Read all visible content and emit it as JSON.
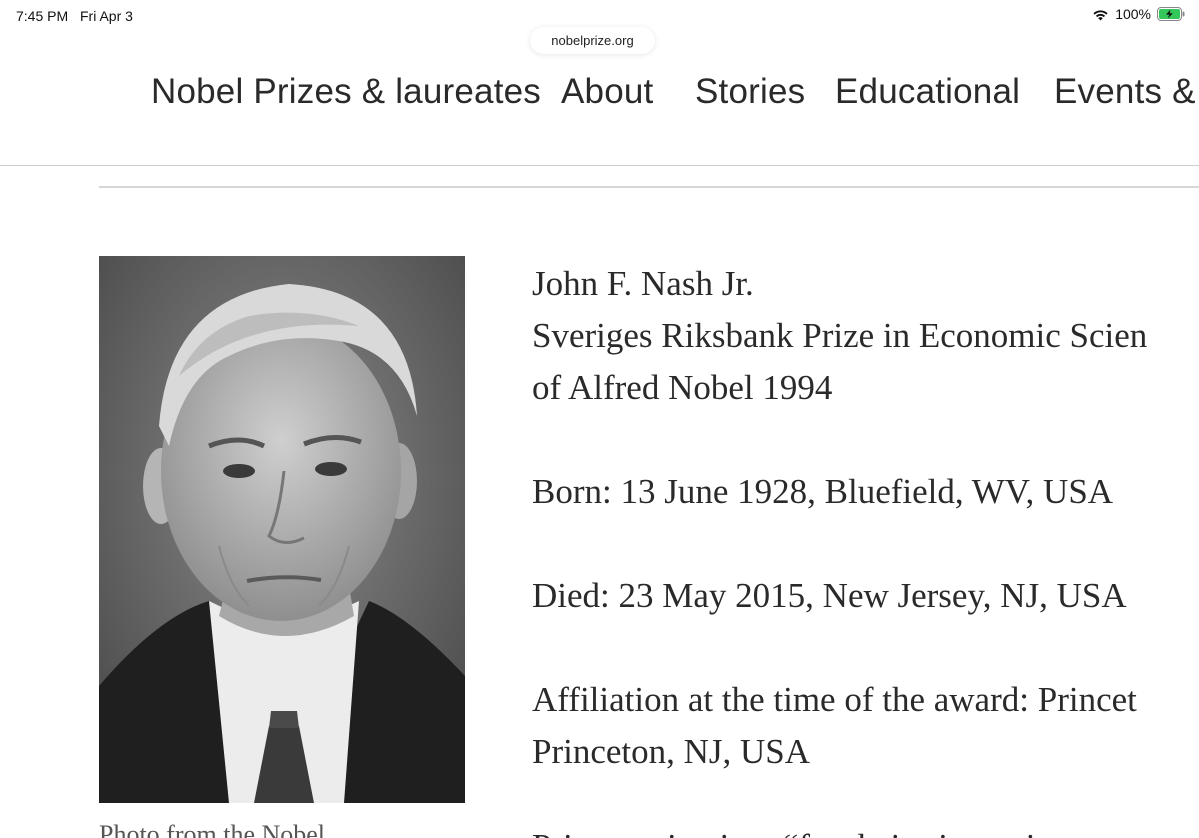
{
  "status_bar": {
    "time": "7:45 PM",
    "date": "Fri Apr 3",
    "battery_percent": "100%",
    "wifi_icon": "wifi-icon",
    "battery_icon": "battery-charging-icon"
  },
  "url_bar": {
    "domain": "nobelprize.org"
  },
  "nav": {
    "items": [
      {
        "label": "Nobel Prizes & laureates"
      },
      {
        "label": "About"
      },
      {
        "label": "Stories"
      },
      {
        "label": "Educational"
      },
      {
        "label": "Events & r"
      }
    ]
  },
  "laureate": {
    "name": "John F. Nash Jr.",
    "prize_line1": "Sveriges Riksbank Prize in Economic Scien",
    "prize_line2": "of Alfred Nobel 1994",
    "born": "Born: 13 June 1928, Bluefield, WV, USA",
    "died": "Died: 23 May 2015, New Jersey, NJ, USA",
    "affiliation_line1": "Affiliation at the time of the award: Princet",
    "affiliation_line2": "Princeton, NJ, USA",
    "photo_caption": "Photo from the Nobel",
    "prize_motivation_partial": "Prize motivation: “for their pioneering"
  }
}
